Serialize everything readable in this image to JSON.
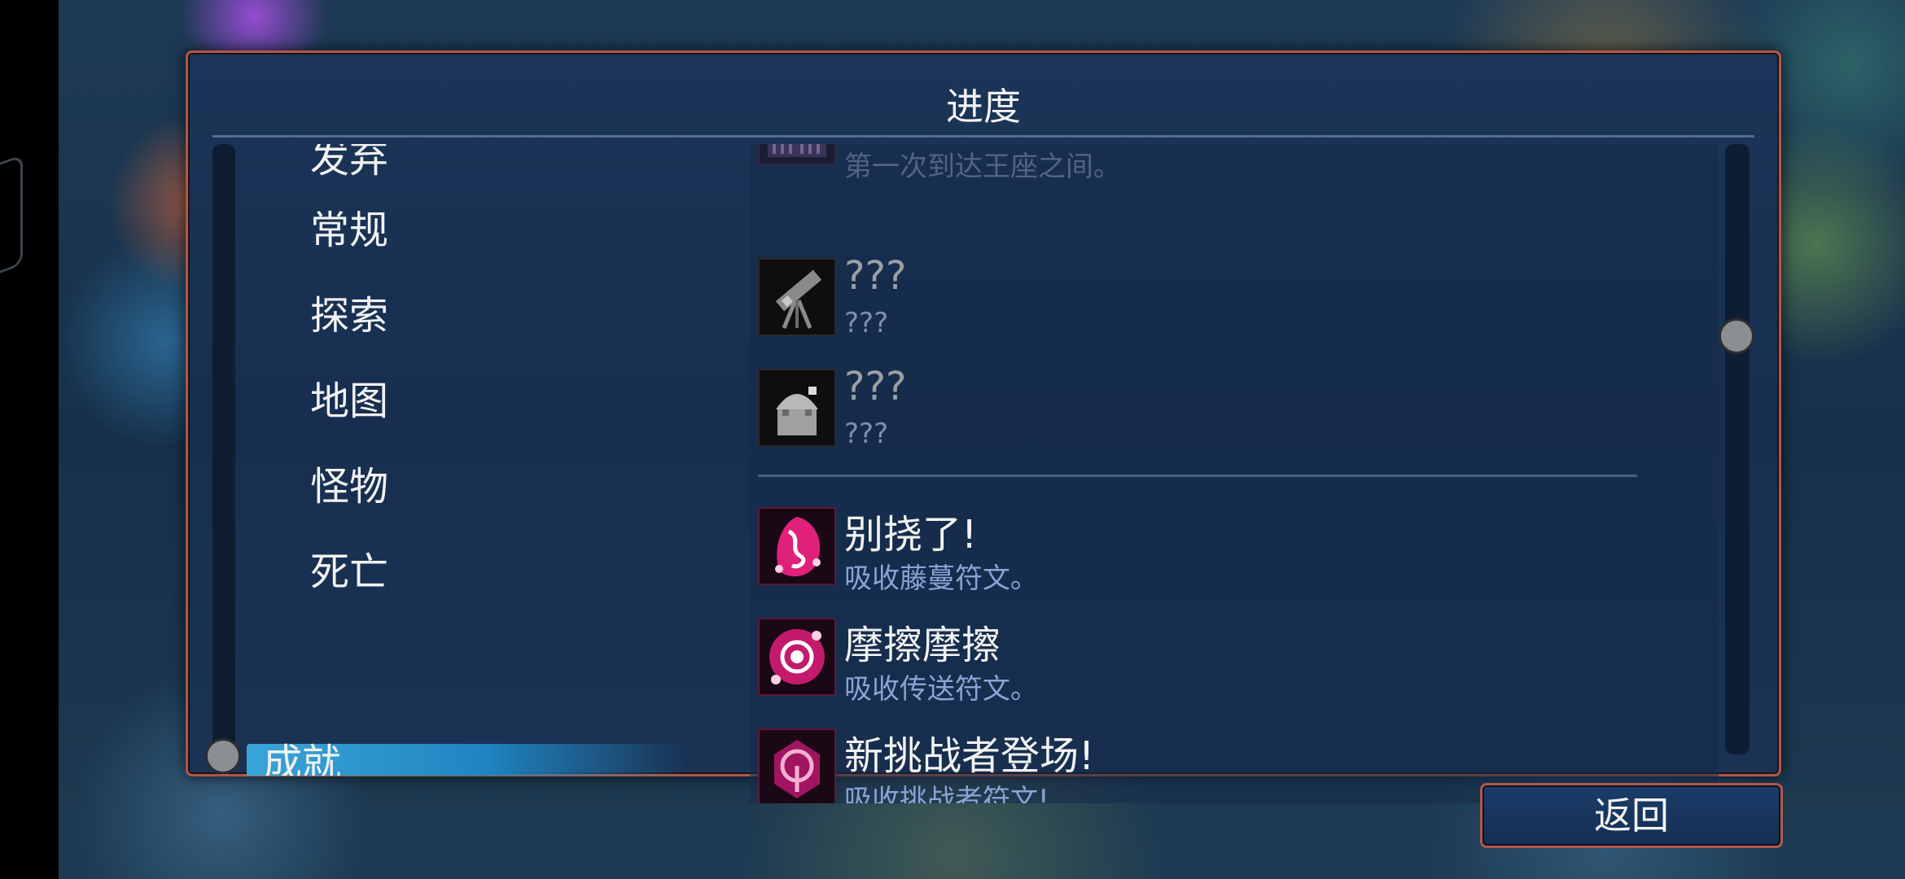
{
  "panel": {
    "title": "进度"
  },
  "categories": [
    {
      "label": "发弃",
      "selected": false
    },
    {
      "label": "常规",
      "selected": false
    },
    {
      "label": "探索",
      "selected": false
    },
    {
      "label": "地图",
      "selected": false
    },
    {
      "label": "怪物",
      "selected": false
    },
    {
      "label": "死亡",
      "selected": false
    },
    {
      "label": "成就",
      "selected": true
    }
  ],
  "achievements": [
    {
      "name": "",
      "description": "第一次到达王座之间。",
      "icon": "throne-icon",
      "locked": false
    },
    {
      "name": "???",
      "description": "???",
      "icon": "telescope-icon",
      "locked": true
    },
    {
      "name": "???",
      "description": "???",
      "icon": "observatory-icon",
      "locked": true
    },
    {
      "name": "别挠了!",
      "description": "吸收藤蔓符文。",
      "icon": "vine-rune-icon",
      "locked": false
    },
    {
      "name": "摩擦摩擦",
      "description": "吸收传送符文。",
      "icon": "teleport-rune-icon",
      "locked": false
    },
    {
      "name": "新挑战者登场!",
      "description": "吸收挑战者符文!",
      "icon": "challenger-rune-icon",
      "locked": false
    }
  ],
  "buttons": {
    "back_label": "返回"
  },
  "colors": {
    "panel_border": "#b0574a",
    "selected_category": "#3aa5d9",
    "rune_pink": "#e0217a",
    "description_text": "#8aa4d6"
  }
}
